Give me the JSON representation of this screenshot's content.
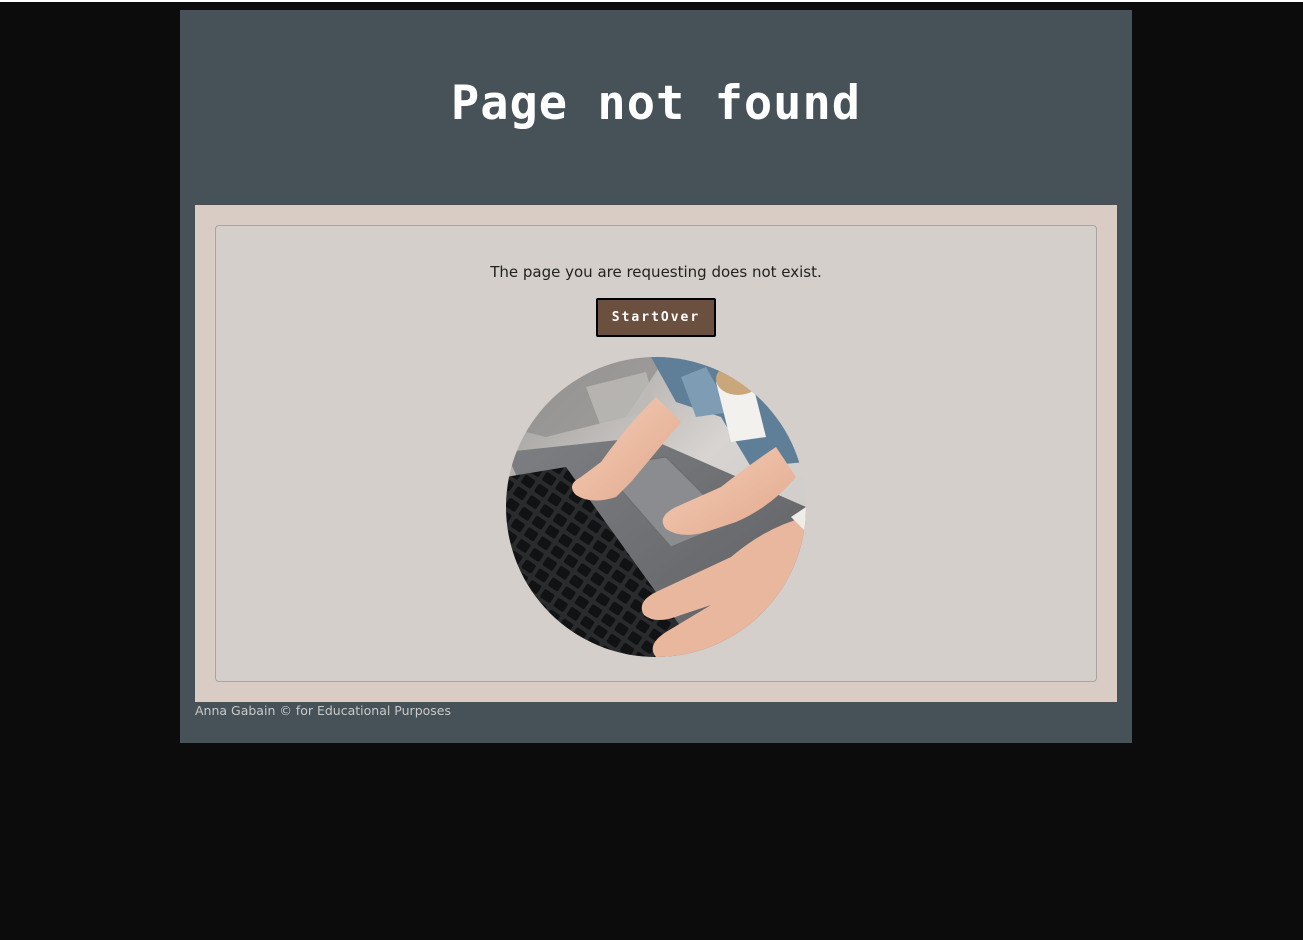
{
  "header": {
    "title": "Page not found"
  },
  "main": {
    "message": "The page you are requesting does not exist.",
    "start_over_label": "StartOver",
    "image": {
      "kind": "photo",
      "subject": "baby-and-adult-hands-on-laptop-keyboard"
    }
  },
  "footer": {
    "text": "Anna Gabain © for Educational Purposes"
  },
  "colors": {
    "page_background": "#0c0c0c",
    "wrapper_background": "#465258",
    "main_background": "#d9ccc5",
    "card_background": "#d4cfcb",
    "button_background": "#6b4f3f",
    "title_color": "#ffffff"
  }
}
